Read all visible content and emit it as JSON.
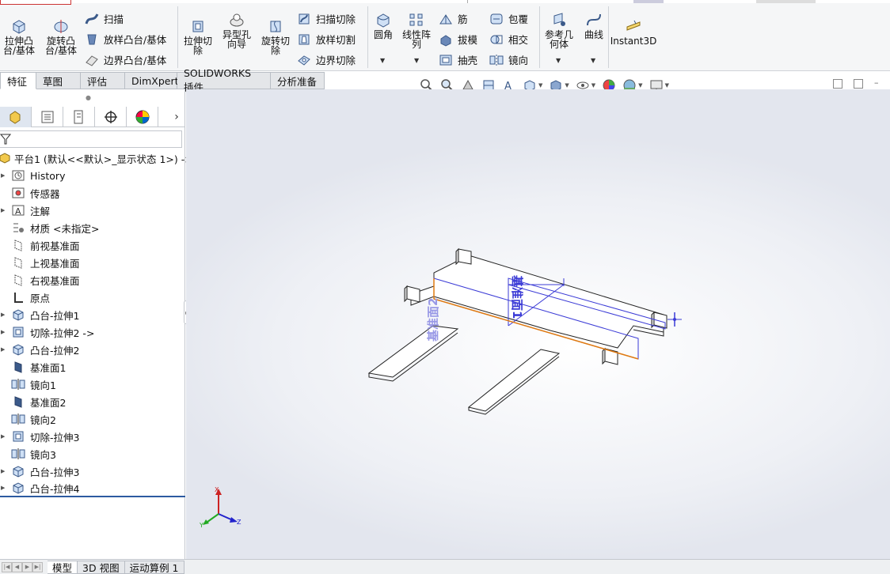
{
  "ribbon": {
    "extrude_boss": "拉伸凸\n台/基体",
    "revolve_boss": "旋转凸\n台/基体",
    "sweep": "扫描",
    "loft_boss": "放样凸台/基体",
    "boundary_boss": "边界凸台/基体",
    "extrude_cut": "拉伸切\n除",
    "hole_wizard": "异型孔\n向导",
    "revolve_cut": "旋转切\n除",
    "swept_cut": "扫描切除",
    "lofted_cut": "放样切割",
    "boundary_cut": "边界切除",
    "fillet": "圆角",
    "linear_pattern": "线性阵\n列",
    "rib": "筋",
    "draft": "拔模",
    "shell": "抽壳",
    "wrap": "包覆",
    "intersect": "相交",
    "mirror": "镜向",
    "ref_geometry": "参考几\n何体",
    "curves": "曲线",
    "instant3d": "Instant3D"
  },
  "command_tabs": [
    "特征",
    "草图",
    "评估",
    "DimXpert",
    "SOLIDWORKS 插件",
    "分析准备"
  ],
  "feature_tree": {
    "root": "平台1  (默认<<默认>_显示状态 1>) ->",
    "items": [
      {
        "label": "History",
        "icon": "history-icon",
        "expand": true
      },
      {
        "label": "传感器",
        "icon": "sensor-icon",
        "expand": false
      },
      {
        "label": "注解",
        "icon": "annotation-icon",
        "expand": true
      },
      {
        "label": "材质 <未指定>",
        "icon": "material-icon",
        "expand": false
      },
      {
        "label": "前视基准面",
        "icon": "plane-icon",
        "expand": false
      },
      {
        "label": "上视基准面",
        "icon": "plane-icon",
        "expand": false
      },
      {
        "label": "右视基准面",
        "icon": "plane-icon",
        "expand": false
      },
      {
        "label": "原点",
        "icon": "origin-icon",
        "expand": false
      },
      {
        "label": "凸台-拉伸1",
        "icon": "extrude-icon",
        "expand": true
      },
      {
        "label": "切除-拉伸2 ->",
        "icon": "cut-extrude-icon",
        "expand": true
      },
      {
        "label": "凸台-拉伸2",
        "icon": "extrude-icon",
        "expand": true
      },
      {
        "label": "基准面1",
        "icon": "plane-solid-icon",
        "expand": false
      },
      {
        "label": "镜向1",
        "icon": "mirror-icon",
        "expand": false
      },
      {
        "label": "基准面2",
        "icon": "plane-solid-icon",
        "expand": false
      },
      {
        "label": "镜向2",
        "icon": "mirror-icon",
        "expand": false
      },
      {
        "label": "切除-拉伸3",
        "icon": "cut-extrude-icon",
        "expand": true
      },
      {
        "label": "镜向3",
        "icon": "mirror-icon",
        "expand": false
      },
      {
        "label": "凸台-拉伸3",
        "icon": "extrude-icon",
        "expand": true
      },
      {
        "label": "凸台-拉伸4",
        "icon": "extrude-icon",
        "expand": true
      }
    ]
  },
  "viewport": {
    "plane1_label": "基准面1",
    "plane2_label": "基准面2",
    "triad_x": "X",
    "triad_y": "Y",
    "triad_z": "Z"
  },
  "bottom_tabs": [
    "模型",
    "3D 视图",
    "运动算例 1"
  ],
  "colors": {
    "accent": "#2c5aa0",
    "plane_blue": "#3b3bd6",
    "edge_orange": "#e07a10"
  }
}
